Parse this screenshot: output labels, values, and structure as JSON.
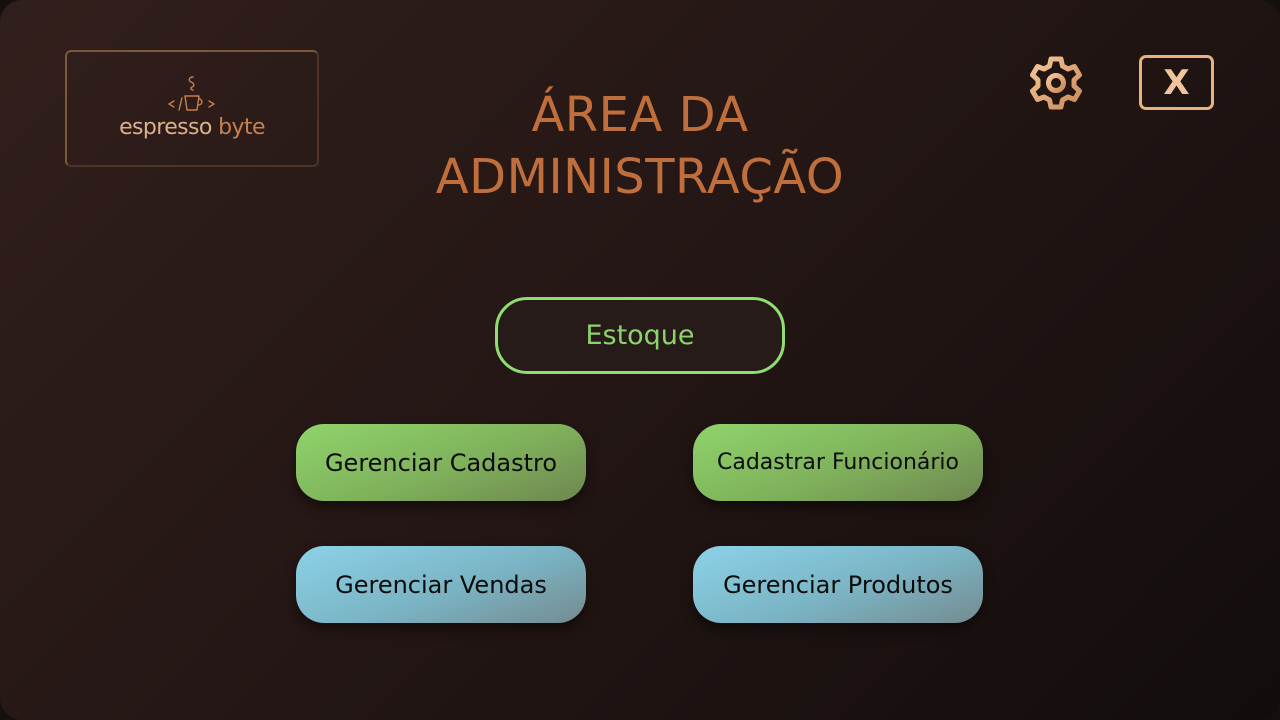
{
  "logo": {
    "word1": "espresso",
    "word2": "byte",
    "icon": "coffee-cup-code-icon"
  },
  "header": {
    "title_line1": "ÁREA DA",
    "title_line2": "ADMINISTRAÇÃO"
  },
  "toolbar": {
    "settings_icon": "gear-icon",
    "close_label": "X"
  },
  "buttons": {
    "stock": "Estoque",
    "manage_registration": "Gerenciar Cadastro",
    "register_employee": "Cadastrar Funcionário",
    "manage_sales": "Gerenciar Vendas",
    "manage_products": "Gerenciar Produtos"
  },
  "colors": {
    "background": "#241715",
    "accent_orange": "#c06e3c",
    "accent_green": "#90dd72",
    "button_green": "#8fd46b",
    "button_blue": "#8cd2e8",
    "close_border": "#e9b17e"
  }
}
